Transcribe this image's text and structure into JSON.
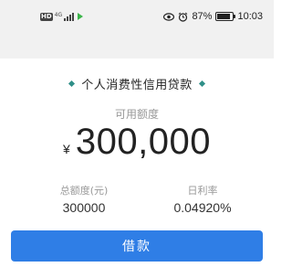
{
  "status_bar": {
    "signal_badge": "HD",
    "network": "4G",
    "battery_percent": "87%",
    "battery_level": 0.87,
    "time": "10:03",
    "icons": [
      "eye-icon",
      "alarm-icon",
      "battery-icon",
      "signal-icon",
      "play-icon"
    ]
  },
  "loan": {
    "title": "个人消费性信用贷款",
    "available_label": "可用额度",
    "currency": "¥",
    "available_amount": "300,000",
    "total_label": "总额度(元)",
    "total_value": "300000",
    "rate_label": "日利率",
    "rate_value": "0.04920%",
    "borrow_label": "借款"
  },
  "colors": {
    "accent": "#2f7ee6",
    "diamond": "#2f8f88",
    "statusbar_bg": "#f1f1f1"
  }
}
